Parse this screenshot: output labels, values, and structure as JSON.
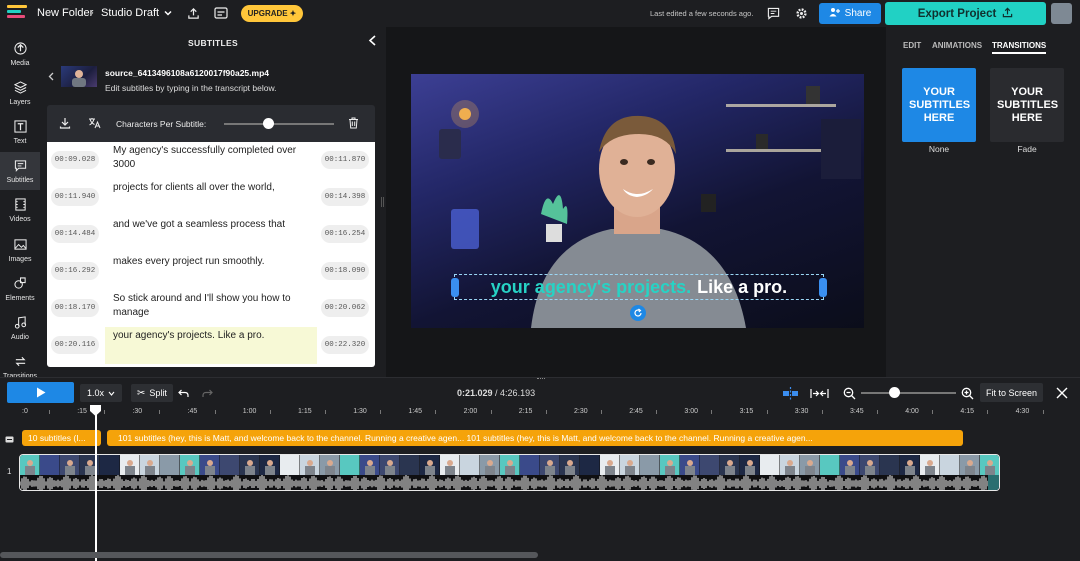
{
  "header": {
    "folder": "New Folder",
    "separator": "›",
    "project": "Studio Draft",
    "upgrade_label": "UPGRADE",
    "last_edited": "Last edited a few seconds ago.",
    "share_label": "Share",
    "export_label": "Export Project"
  },
  "sidebar": {
    "items": [
      {
        "label": "Media",
        "icon": "media-icon"
      },
      {
        "label": "Layers",
        "icon": "layers-icon"
      },
      {
        "label": "Text",
        "icon": "text-icon"
      },
      {
        "label": "Subtitles",
        "icon": "subtitles-icon",
        "active": true
      },
      {
        "label": "Videos",
        "icon": "videos-icon"
      },
      {
        "label": "Images",
        "icon": "images-icon"
      },
      {
        "label": "Elements",
        "icon": "elements-icon"
      },
      {
        "label": "Audio",
        "icon": "audio-icon"
      },
      {
        "label": "Transitions",
        "icon": "transitions-icon"
      }
    ]
  },
  "subtitles_panel": {
    "title": "SUBTITLES",
    "file_name": "source_6413496108a6120017f90a25.mp4",
    "instruction": "Edit subtitles by typing in the transcript below.",
    "chars_label": "Characters Per Subtitle:",
    "chars_slider_fraction": 0.4,
    "rows": [
      {
        "start": "00:09.028",
        "text": "My agency's successfully completed over 3000",
        "end": "00:11.870"
      },
      {
        "start": "00:11.940",
        "text": "projects for clients all over the world,",
        "end": "00:14.398"
      },
      {
        "start": "00:14.484",
        "text": "and we've got a seamless process that",
        "end": "00:16.254"
      },
      {
        "start": "00:16.292",
        "text": "makes every project run smoothly.",
        "end": "00:18.090"
      },
      {
        "start": "00:18.170",
        "text": "So stick around and I'll show you how to manage",
        "end": "00:20.062"
      },
      {
        "start": "00:20.116",
        "text": "your agency's projects. Like a pro.",
        "end": "00:22.320",
        "highlighted": true
      }
    ]
  },
  "preview": {
    "caption_accent": "your agency's projects.",
    "caption_rest": "Like a pro.",
    "accent_color": "#27d3c5"
  },
  "right_panel": {
    "tabs": [
      "EDIT",
      "ANIMATIONS",
      "TRANSITIONS"
    ],
    "active_tab": "TRANSITIONS",
    "cards": [
      {
        "text": "YOUR SUBTITLES HERE",
        "label": "None",
        "color": "#1e88e5"
      },
      {
        "text": "YOUR SUBTITLES HERE",
        "label": "Fade",
        "color": "#2a2b2f"
      }
    ]
  },
  "timeline": {
    "speed": "1.0x",
    "split_label": "Split",
    "current_time": "0:21.029",
    "duration": "4:26.193",
    "time_display": "0:21.029 / 4:26.193",
    "fit_label": "Fit to Screen",
    "zoom_fraction": 0.35,
    "ticks": [
      ":0",
      ":15",
      ":30",
      ":45",
      "1:00",
      "1:15",
      "1:30",
      "1:45",
      "2:00",
      "2:15",
      "2:30",
      "2:45",
      "3:00",
      "3:15",
      "3:30",
      "3:45",
      "4:00",
      "4:15",
      "4:30"
    ],
    "subtitle_track_1": "10 subtitles (I...",
    "subtitle_track_2": "101 subtitles (hey, this is Matt, and welcome back to the channel. Running a creative agen... 101 subtitles (hey, this is Matt, and welcome back to the channel. Running a creative agen...",
    "track_number": "1",
    "brand_color": "#1e88e5",
    "subtitle_track_color": "#f5a30a"
  }
}
